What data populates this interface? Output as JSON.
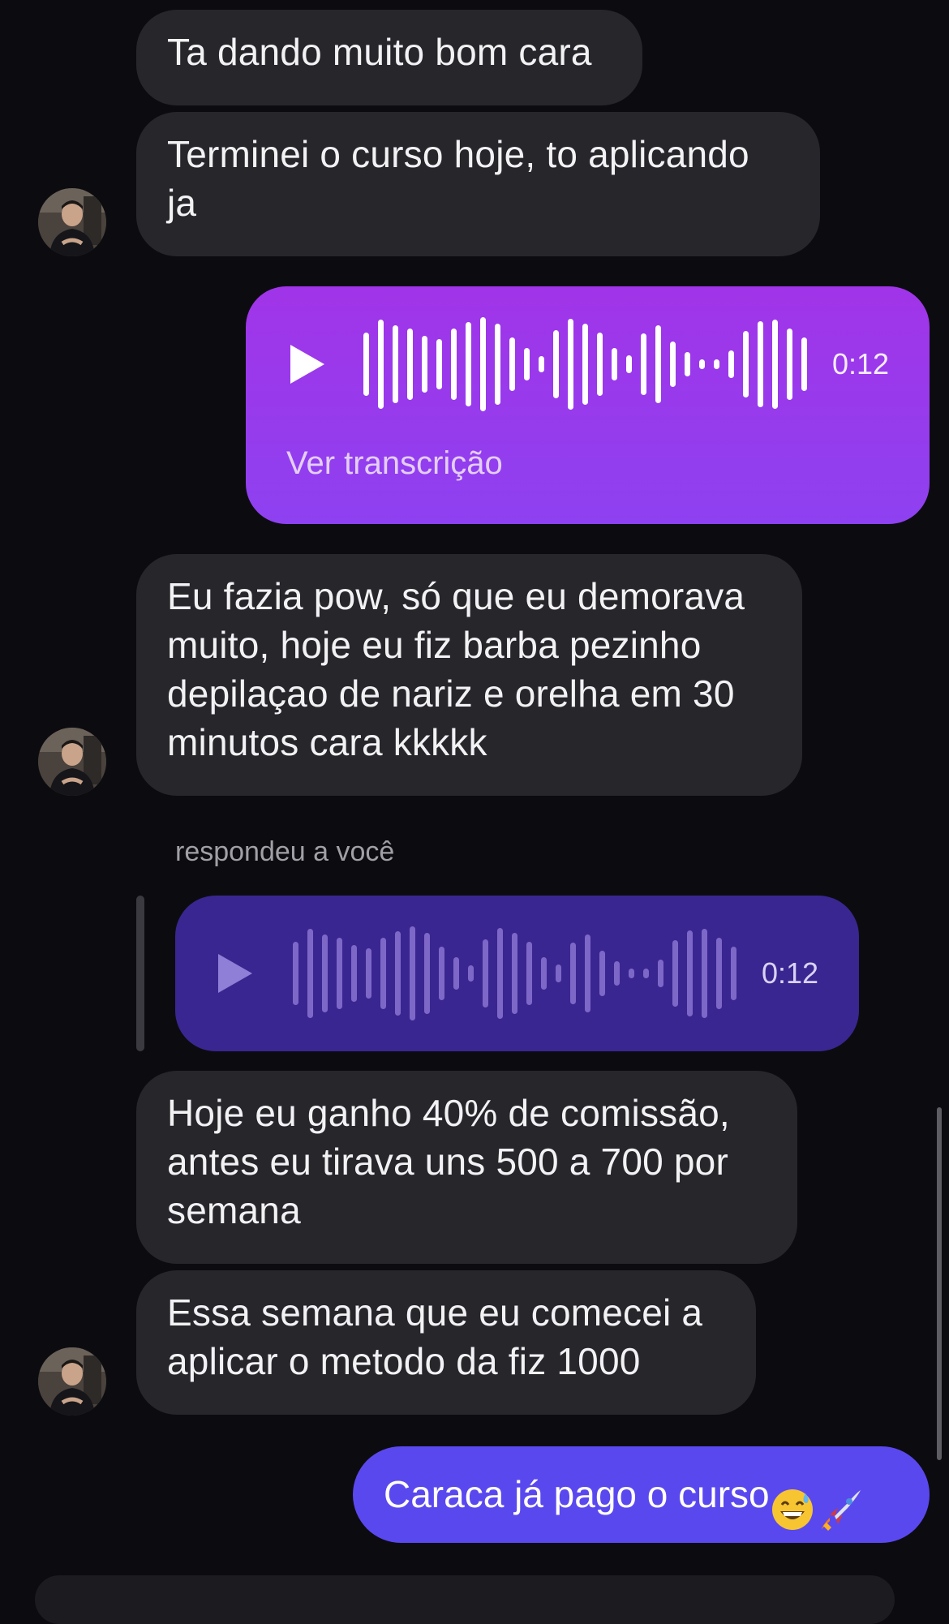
{
  "messages": [
    {
      "id": "m1",
      "sender": "contact",
      "text": "Ta dando muito bom cara"
    },
    {
      "id": "m2",
      "sender": "contact",
      "line1": "Terminei o curso hoje, to aplicando",
      "line2": "ja"
    },
    {
      "id": "m3",
      "sender": "me",
      "type": "voice",
      "duration": "0:12",
      "transcript_link": "Ver transcrição"
    },
    {
      "id": "m4",
      "sender": "contact",
      "line1": "Eu fazia pow, só que eu demorava",
      "line2": "muito, hoje eu fiz barba pezinho",
      "line3": "depilaçao de nariz e orelha em 30",
      "line4": "minutos cara kkkkk"
    },
    {
      "id": "m5",
      "sender": "contact",
      "reply_label": "respondeu a você",
      "quoted_duration": "0:12"
    },
    {
      "id": "m6",
      "sender": "contact",
      "line1": "Hoje eu ganho 40% de comissão,",
      "line2": "antes eu tirava uns 500 a 700 por",
      "line3": "semana"
    },
    {
      "id": "m7",
      "sender": "contact",
      "line1": "Essa semana que eu comecei a",
      "line2": "aplicar o metodo da fiz 1000"
    },
    {
      "id": "m8",
      "sender": "me",
      "text": "Caraca já pago o curso",
      "emojis": [
        "grinning-sweat-emoji",
        "rocket-emoji"
      ]
    }
  ],
  "colors": {
    "background": "#0c0c10",
    "incoming_bubble": "#26262b",
    "outgoing_voice": "#a134e8",
    "quoted_voice": "#3a2690",
    "outgoing_text": "#5a48ef"
  },
  "icons": {
    "play": "play-icon",
    "avatar": "contact-avatar"
  }
}
